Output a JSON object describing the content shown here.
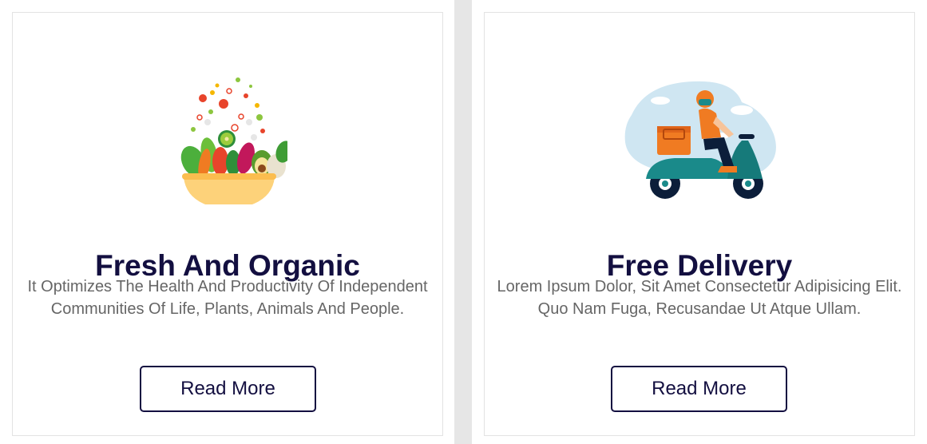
{
  "cards": [
    {
      "title": "Fresh And Organic",
      "description": "It Optimizes The Health And Productivity Of Independent Communities Of Life, Plants, Animals And People.",
      "button_label": "Read More",
      "image_icon": "salad-bowl-icon"
    },
    {
      "title": "Free Delivery",
      "description": "Lorem Ipsum Dolor, Sit Amet Consectetur Adipisicing Elit. Quo Nam Fuga, Recusandae Ut Atque Ullam.",
      "button_label": "Read More",
      "image_icon": "delivery-scooter-icon"
    }
  ],
  "colors": {
    "heading": "#130f40",
    "text": "#666666",
    "page_gap": "#e6e6e6",
    "card_border": "#e3e3e3"
  }
}
